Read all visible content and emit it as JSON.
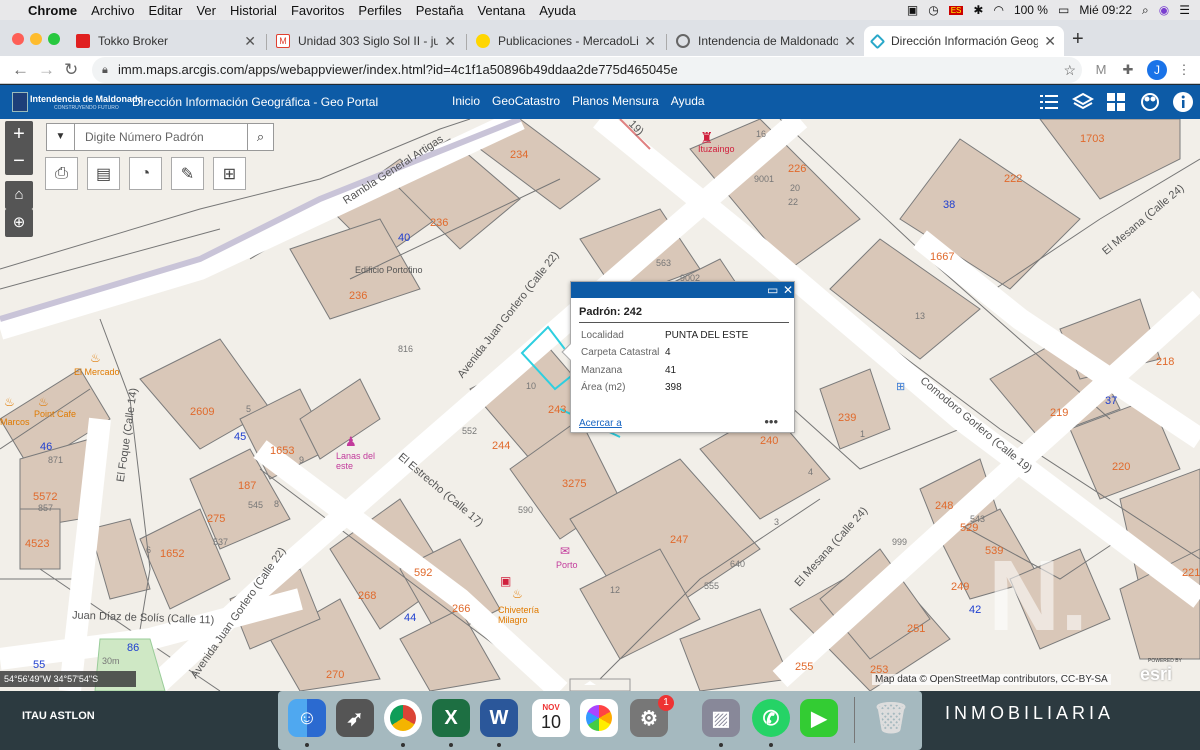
{
  "menubar": {
    "app": "Chrome",
    "items": [
      "Archivo",
      "Editar",
      "Ver",
      "Historial",
      "Favoritos",
      "Perfiles",
      "Pestaña",
      "Ventana",
      "Ayuda"
    ],
    "battery": "100 %",
    "clock": "Mié 09:22"
  },
  "tabs": [
    {
      "title": "Tokko Broker",
      "color": "#e02020"
    },
    {
      "title": "Unidad 303 Siglo Sol II - juanc",
      "color": "#e04030"
    },
    {
      "title": "Publicaciones - MercadoLibre",
      "color": "#ffd600"
    },
    {
      "title": "Intendencia de Maldonado - U",
      "color": "#666666"
    },
    {
      "title": "Dirección Información Geográf",
      "color": "#2aa8c9"
    }
  ],
  "address": {
    "url": "imm.maps.arcgis.com/apps/webappviewer/index.html?id=4c1f1a50896b49ddaa2de775d465045e"
  },
  "profile_initial": "J",
  "header": {
    "logo_text": "Intendencia de Maldonado",
    "logo_sub": "CONSTRUYENDO FUTURO",
    "title": "Dirección Información Geográfica - Geo Portal",
    "nav": [
      "Inicio",
      "GeoCatastro",
      "Planos Mensura",
      "Ayuda"
    ]
  },
  "search": {
    "placeholder": "Digite Número Padrón"
  },
  "popup": {
    "title": "Padrón: 242",
    "rows": [
      {
        "label": "Localidad",
        "value": "PUNTA DEL ESTE"
      },
      {
        "label": "Carpeta Catastral",
        "value": "4"
      },
      {
        "label": "Manzana",
        "value": "41"
      },
      {
        "label": "Área (m2)",
        "value": "398"
      }
    ],
    "action": "Acercar a",
    "more": "•••"
  },
  "map": {
    "parcels": [
      "234",
      "226",
      "1703",
      "222",
      "236",
      "236",
      "40",
      "38",
      "1667",
      "563",
      "9002",
      "242",
      "243",
      "244",
      "239",
      "218",
      "2609",
      "1653",
      "45",
      "46",
      "187",
      "275",
      "1652",
      "5572",
      "4523",
      "3275",
      "247",
      "219",
      "37",
      "220",
      "240",
      "248",
      "529",
      "539",
      "592",
      "268",
      "266",
      "44",
      "270",
      "255",
      "253",
      "251",
      "249",
      "221",
      "86",
      "55",
      "42",
      "816",
      "552",
      "590",
      "555",
      "640",
      "545",
      "537",
      "857",
      "871",
      "1",
      "3",
      "4",
      "5",
      "6",
      "8",
      "9",
      "10",
      "12",
      "13",
      "16",
      "20",
      "22",
      "30m",
      "9001",
      "999",
      "543"
    ],
    "roads": [
      "Rambla General Artigas",
      "Avenida Juan Gorlero (Calle 22)",
      "El Foque (Calle 14)",
      "El Estrecho (Calle 17)",
      "Juan Díaz de Solís (Calle 11)",
      "Avenida Juan Gorlero (Calle 22)",
      "El Mesana (Calle 24)",
      "Comodoro Gorlero (Calle 19)",
      "El Mesana (Calle 24)",
      "19)"
    ],
    "pois": [
      "Ituzaingo",
      "Edificio Portofino",
      "El Mercado",
      "Lanas del este",
      "Porto",
      "Chivetería Milagro",
      "Point Cafe",
      "Marcos"
    ]
  },
  "coords": "54°56'49\"W 34°57'54\"S",
  "attribution": "Map data © OpenStreetMap contributors, CC-BY-SA",
  "esri": "esri",
  "powered": "POWERED BY",
  "watermark": {
    "letter": "N.",
    "text": "INMOBILIARIA",
    "brand": "ITAU ASTLON"
  },
  "dock": {
    "calendar_month": "NOV",
    "calendar_day": "10",
    "badge": "1"
  }
}
